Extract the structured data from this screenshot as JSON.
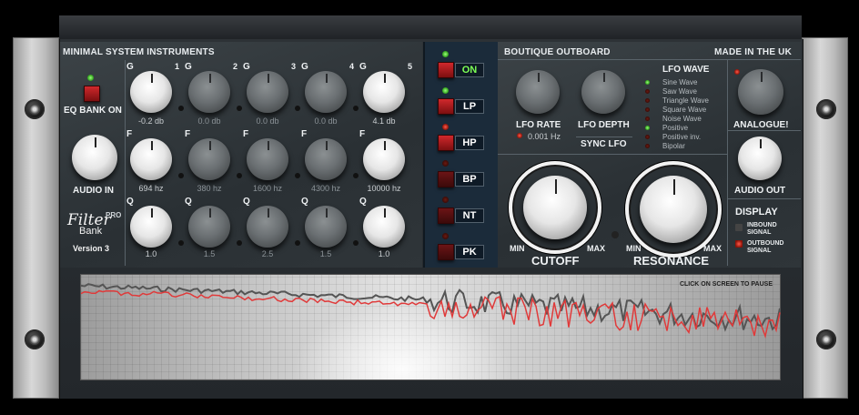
{
  "left": {
    "title": "MINIMAL SYSTEM INSTRUMENTS",
    "eq_bank_label": "EQ BANK ON",
    "audio_in_label": "AUDIO IN",
    "brand": {
      "name": "Filter",
      "suffix": "PRO",
      "sub": "Bank",
      "version": "Version 3"
    },
    "bands": [
      {
        "num": "1",
        "gain": "-0.2 db",
        "freq": "694 hz",
        "q": "1.0",
        "active": true
      },
      {
        "num": "2",
        "gain": "0.0 db",
        "freq": "380 hz",
        "q": "1.5",
        "active": false
      },
      {
        "num": "3",
        "gain": "0.0 db",
        "freq": "1600 hz",
        "q": "2.5",
        "active": false
      },
      {
        "num": "4",
        "gain": "0.0 db",
        "freq": "4300 hz",
        "q": "1.5",
        "active": false
      },
      {
        "num": "5",
        "gain": "4.1 db",
        "freq": "10000 hz",
        "q": "1.0",
        "active": true
      }
    ],
    "row_letters": {
      "g": "G",
      "f": "F",
      "q": "Q"
    }
  },
  "mid": {
    "buttons": [
      {
        "label": "ON",
        "active": true
      },
      {
        "label": "LP",
        "active": true
      },
      {
        "label": "HP",
        "active": true
      },
      {
        "label": "BP",
        "active": false
      },
      {
        "label": "NT",
        "active": false
      },
      {
        "label": "PK",
        "active": false
      }
    ]
  },
  "right": {
    "title": "BOUTIQUE OUTBOARD",
    "made_in": "MADE IN THE UK",
    "lfo_rate_label": "LFO RATE",
    "lfo_rate_value": "0.001 Hz",
    "lfo_depth_label": "LFO DEPTH",
    "sync_lfo_label": "SYNC LFO",
    "lfo_wave_title": "LFO WAVE",
    "waves": [
      "Sine Wave",
      "Saw Wave",
      "Triangle Wave",
      "Square Wave",
      "Noise Wave"
    ],
    "polarity": [
      "Positive",
      "Positive inv.",
      "Bipolar"
    ],
    "analogue_label": "ANALOGUE!",
    "audio_out_label": "AUDIO OUT",
    "display_label": "DISPLAY",
    "inbound_label": "INBOUND SIGNAL",
    "outbound_label": "OUTBOUND SIGNAL",
    "cutoff_label": "CUTOFF",
    "resonance_label": "RESONANCE",
    "min_label": "MIN",
    "max_label": "MAX"
  },
  "display": {
    "hint": "CLICK ON SCREEN TO PAUSE",
    "colors": {
      "inbound": "#555555",
      "outbound": "#e03a3a"
    }
  }
}
